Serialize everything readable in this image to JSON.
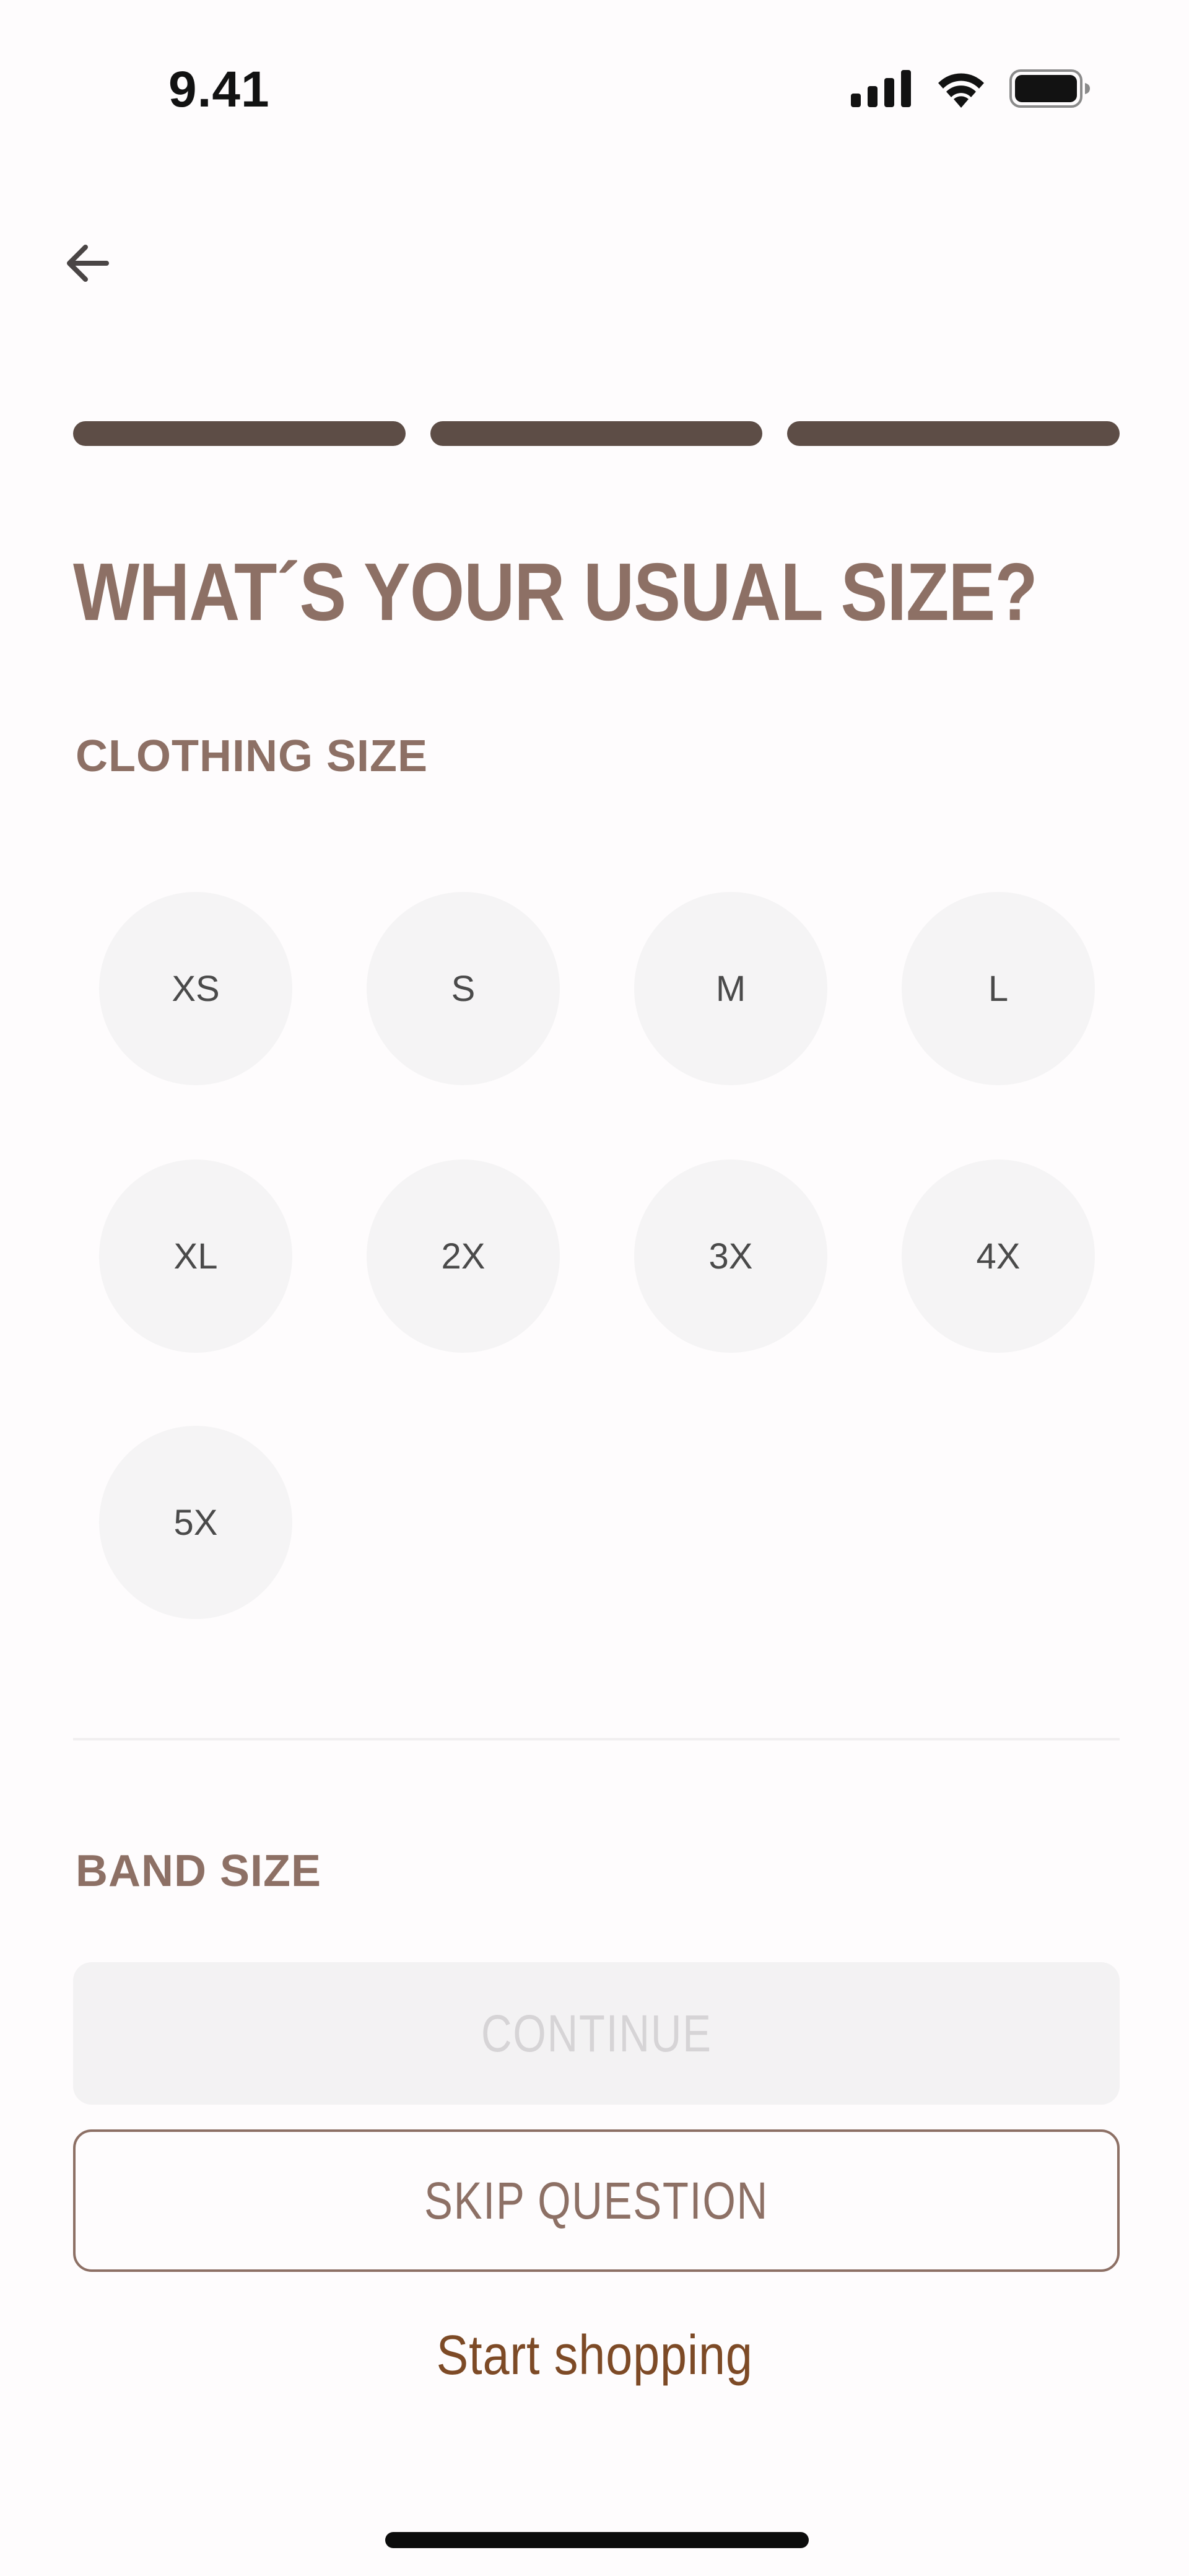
{
  "status_bar": {
    "time": "9.41",
    "icons": [
      "cellular-signal-icon",
      "wifi-icon",
      "battery-icon"
    ]
  },
  "nav": {
    "back_icon": "arrow-left-icon"
  },
  "progress": {
    "steps_total": 3,
    "steps_completed": 3,
    "color": "#5d4d46"
  },
  "title": "WHAT´S YOUR USUAL SIZE?",
  "clothing_size": {
    "label": "CLOTHING SIZE",
    "options": [
      "XS",
      "S",
      "M",
      "L",
      "XL",
      "2X",
      "3X",
      "4X",
      "5X"
    ]
  },
  "band_size": {
    "label": "BAND SIZE"
  },
  "buttons": {
    "continue": "CONTINUE",
    "skip": "SKIP QUESTION",
    "start_shopping": "Start shopping"
  },
  "colors": {
    "accent": "#8d7065",
    "link": "#7d4a26",
    "background": "#fefcfd",
    "option_bg": "#f5f4f5"
  }
}
